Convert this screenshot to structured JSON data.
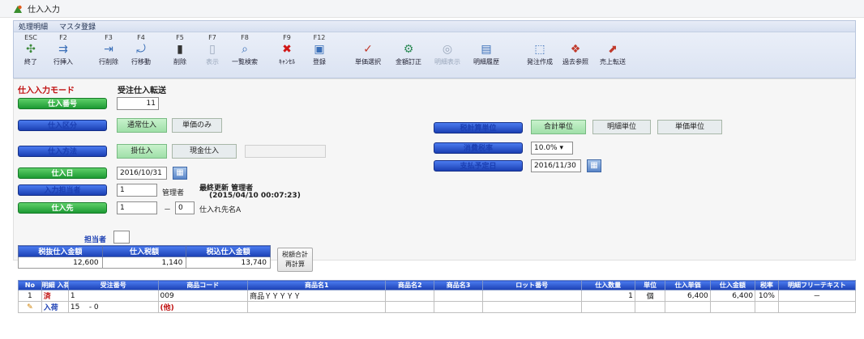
{
  "window": {
    "title": "仕入入力"
  },
  "menu": [
    "処理明細",
    "マスタ登録"
  ],
  "toolbar": [
    {
      "key": "ESC",
      "label": "終了",
      "icon": "exit-icon"
    },
    {
      "key": "F2",
      "label": "行挿入",
      "icon": "insert-row-icon"
    },
    {
      "key": "F3",
      "label": "行削除",
      "icon": "delete-row-icon"
    },
    {
      "key": "F4",
      "label": "行移動",
      "icon": "move-row-icon"
    },
    {
      "key": "F5",
      "label": "削除",
      "icon": "delete-icon"
    },
    {
      "key": "F7",
      "label": "表示",
      "icon": "view-icon"
    },
    {
      "key": "F8",
      "label": "一覧検索",
      "icon": "list-search-icon"
    },
    {
      "key": "F9",
      "label": "ｷｬﾝｾﾙ",
      "icon": "cancel-icon"
    },
    {
      "key": "F12",
      "label": "登録",
      "icon": "save-icon"
    },
    {
      "key": "",
      "label": "単価選択",
      "icon": "price-select-icon"
    },
    {
      "key": "",
      "label": "金額訂正",
      "icon": "amount-fix-icon"
    },
    {
      "key": "",
      "label": "明細表示",
      "icon": "detail-view-icon"
    },
    {
      "key": "",
      "label": "明細履歴",
      "icon": "history-icon"
    },
    {
      "key": "",
      "label": "発注作成",
      "icon": "order-create-icon"
    },
    {
      "key": "",
      "label": "過去参照",
      "icon": "past-ref-icon"
    },
    {
      "key": "",
      "label": "売上転送",
      "icon": "sales-transfer-icon"
    }
  ],
  "form": {
    "mode_title": "仕入入力モード",
    "mode_value": "受注仕入転送",
    "slip_no_label": "仕入番号",
    "slip_no_value": "11",
    "category_label": "仕入区分",
    "category_opt1": "通常仕入",
    "category_opt2": "単価のみ",
    "kind_label": "仕入方法",
    "kind_opt1": "掛仕入",
    "kind_opt2": "現金仕入",
    "date_label": "仕入日",
    "date_value": "2016/10/31",
    "person_label": "入力担当者",
    "person_value": "1",
    "person_name": "管理者",
    "last_update_title": "最終更新 管理者",
    "last_update_time": "(2015/04/10 00:07:23)",
    "supplier_label": "仕入先",
    "supplier_code": "1",
    "supplier_sub": "0",
    "supplier_name": "仕入れ先名A",
    "buyer_label": "担当者",
    "tax_unit_label": "税計算単位",
    "tax_unit_opt1": "合計単位",
    "tax_unit_opt2": "明細単位",
    "tax_unit_opt3": "単価単位",
    "tax_rate_label": "消費税率",
    "tax_rate_value": "10.0% ▾",
    "pay_date_label": "支払予定日",
    "pay_date_value": "2016/11/30"
  },
  "summary": {
    "headers": [
      "税抜仕入金額",
      "仕入税額",
      "税込仕入金額"
    ],
    "values": [
      "12,600",
      "1,140",
      "13,740"
    ],
    "button_line1": "税額合計",
    "button_line2": "再計算"
  },
  "grid": {
    "headers": [
      "No",
      "明細\n入荷",
      "受注番号",
      "商品コード",
      "商品名1",
      "商品名2",
      "商品名3",
      "ロット番号",
      "仕入数量",
      "単位",
      "仕入単価",
      "仕入金額",
      "税率",
      "明細フリーテキスト"
    ],
    "row": {
      "no": "1",
      "status": "済",
      "status2": "入荷",
      "order_no": "1",
      "order_line": "15",
      "order_sub": "- 0",
      "product_code": "009",
      "product_code2": "(他)",
      "product_name": "商品ＹＹＹＹＹ",
      "qty": "1",
      "unit": "個",
      "unit_price": "6,400",
      "amount": "6,400",
      "tax": "10%",
      "free": "－"
    }
  },
  "colors": {
    "accent_blue": "#1b3fb3",
    "accent_green": "#1c9a33",
    "mode_red": "#c01010"
  }
}
